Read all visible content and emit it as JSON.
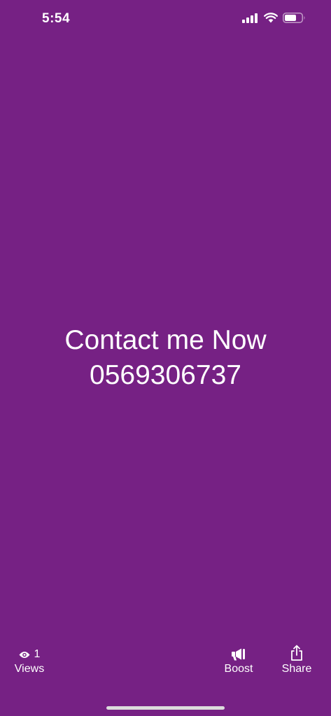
{
  "status_bar": {
    "time": "5:54",
    "icons": [
      "cellular-signal-icon",
      "wifi-icon",
      "battery-icon"
    ]
  },
  "story": {
    "line1": "Contact me Now",
    "line2": "0569306737",
    "background_color": "#762184"
  },
  "footer": {
    "views_count": "1",
    "views_label": "Views",
    "views_icon": "eye-icon",
    "boost_label": "Boost",
    "boost_icon": "megaphone-icon",
    "share_label": "Share",
    "share_icon": "share-icon"
  }
}
